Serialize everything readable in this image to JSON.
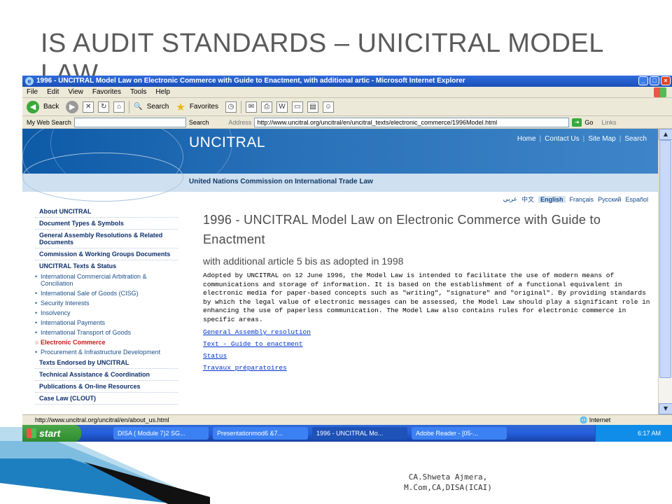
{
  "slide": {
    "title": "IS AUDIT STANDARDS – UNICITRAL MODEL LAW",
    "footer_line1": "CA.Shweta Ajmera,",
    "footer_line2": "M.Com,CA,DISA(ICAI)"
  },
  "window": {
    "title": "1996 - UNCITRAL Model Law on Electronic Commerce with Guide to Enactment, with additional artic - Microsoft Internet Explorer"
  },
  "menu": [
    "File",
    "Edit",
    "View",
    "Favorites",
    "Tools",
    "Help"
  ],
  "toolbar": {
    "back": "Back",
    "search": "Search",
    "favorites": "Favorites"
  },
  "address_bar": {
    "my_web_search": "My Web Search",
    "search_btn": "Search",
    "address_label": "Address",
    "url": "http://www.uncitral.org/uncitral/en/uncitral_texts/electronic_commerce/1996Model.html",
    "go": "Go",
    "links": "Links"
  },
  "site": {
    "brand": "UNCITRAL",
    "nav": [
      "Home",
      "Contact Us",
      "Site Map",
      "Search"
    ],
    "subtitle": "United Nations Commission on International Trade Law",
    "languages": [
      "عربي",
      "中文",
      "English",
      "Français",
      "Русский",
      "Español"
    ],
    "active_language": "English"
  },
  "sidebar": {
    "items_top": [
      "About UNCITRAL",
      "Document Types & Symbols",
      "General Assembly Resolutions & Related Documents",
      "Commission & Working Groups Documents"
    ],
    "texts_status": "UNCITRAL Texts & Status",
    "sub_items": [
      "International Commercial Arbitration & Conciliation",
      "International Sale of Goods (CISG)",
      "Security Interests",
      "Insolvency",
      "International Payments",
      "International Transport of Goods",
      "Electronic Commerce",
      "Procurement & Infrastructure Development"
    ],
    "items_bottom": [
      "Texts Endorsed by UNCITRAL",
      "Technical Assistance & Coordination",
      "Publications & On-line Resources",
      "Case Law (CLOUT)"
    ]
  },
  "content": {
    "heading": "1996 - UNCITRAL Model Law on Electronic Commerce with Guide to Enactment",
    "subheading": "with additional article 5 bis as adopted in 1998",
    "body": "Adopted by UNCITRAL on 12 June 1996, the Model Law is intended to facilitate the use of modern means of communications and storage of information. It is based on the establishment of a functional equivalent in electronic media for paper-based concepts such as \"writing\", \"signature\" and \"original\". By providing standards by which the legal value of electronic messages can be assessed, the Model Law should play a significant role in enhancing the use of paperless communication. The Model Law also contains rules for electronic commerce in specific areas.",
    "links": [
      "General Assembly resolution",
      "Text - Guide to enactment",
      "Status",
      "Travaux préparatoires"
    ]
  },
  "statusbar": {
    "url": "http://www.uncitral.org/uncitral/en/about_us.html",
    "zone": "Internet"
  },
  "taskbar": {
    "start": "start",
    "tasks": [
      "DISA ( Module 7)2 SG...",
      "Presentationmod6 &7...",
      "1996 - UNCITRAL Mo...",
      "Adobe Reader - [05-..."
    ],
    "clock": "6:17 AM"
  }
}
